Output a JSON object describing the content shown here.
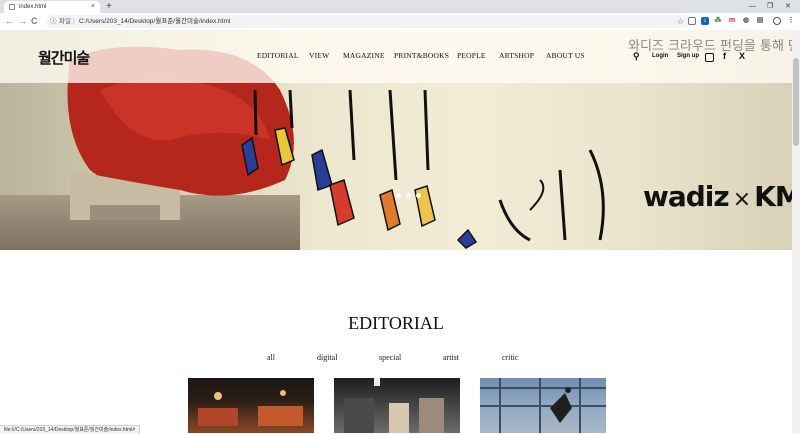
{
  "browser": {
    "tab_title": "index.html",
    "new_tab": "+",
    "minimize": "—",
    "restore": "❐",
    "close": "✕",
    "back": "←",
    "forward": "→",
    "reload": "C",
    "info_icon": "ⓘ",
    "protocol_label": "파일",
    "url": "C:/Users/203_14/Desktop/월표준/월간미술/index.html",
    "star": "☆",
    "status_url": "file:///C:/Users/203_14/Desktop/월표준/월간미술/index.html#"
  },
  "header": {
    "logo": "월간미술",
    "nav": [
      "EDITORIAL",
      "VIEW",
      "MAGAZINE",
      "PRINT&BOOKS",
      "PEOPLE",
      "ARTSHOP",
      "ABOUT US"
    ],
    "top_ad": "와디즈 크라우드 펀딩을 통해 만",
    "login": "Login",
    "signup": "Sign up"
  },
  "hero": {
    "caption_left": "wadiz",
    "caption_x": "×",
    "caption_right": "KM",
    "slide_count": 3
  },
  "editorial": {
    "title": "EDITORIAL",
    "filters": [
      "all",
      "digital",
      "special",
      "artist",
      "critic"
    ]
  }
}
